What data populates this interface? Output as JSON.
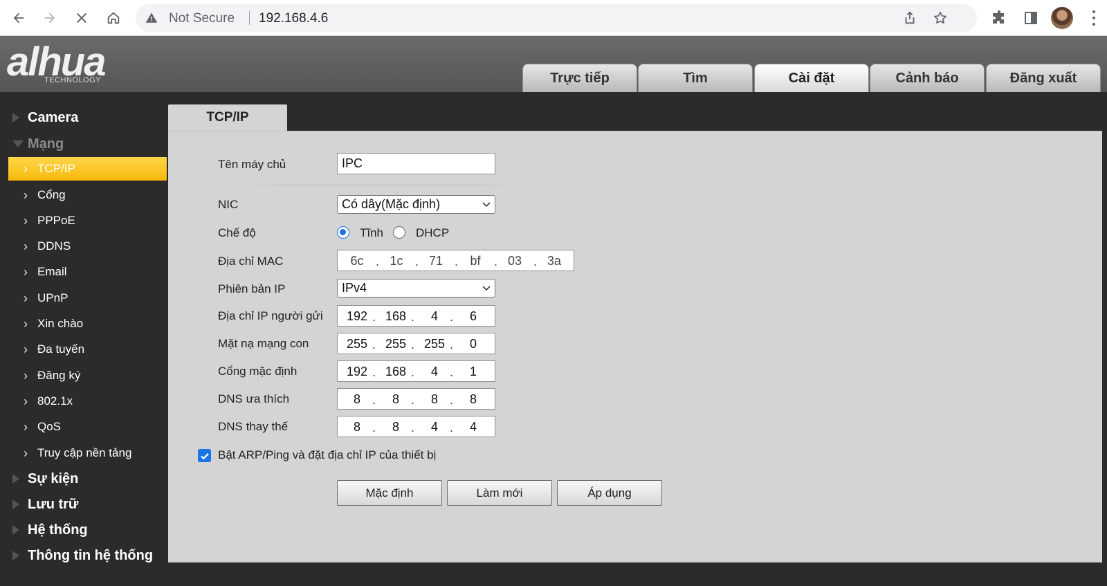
{
  "browser": {
    "security_label": "Not Secure",
    "url": "192.168.4.6"
  },
  "logo": {
    "main": "alhua",
    "sub": "TECHNOLOGY"
  },
  "top_tabs": [
    {
      "label": "Trực tiếp"
    },
    {
      "label": "Tìm"
    },
    {
      "label": "Cài đặt",
      "active": true
    },
    {
      "label": "Cảnh báo"
    },
    {
      "label": "Đăng xuất"
    }
  ],
  "sidebar": {
    "groups": [
      {
        "label": "Camera"
      },
      {
        "label": "Mạng",
        "open": true
      },
      {
        "label": "Sự kiện"
      },
      {
        "label": "Lưu trữ"
      },
      {
        "label": "Hệ thống"
      },
      {
        "label": "Thông tin hệ thống"
      }
    ],
    "network_items": [
      {
        "label": "TCP/IP",
        "active": true
      },
      {
        "label": "Cổng"
      },
      {
        "label": "PPPoE"
      },
      {
        "label": "DDNS"
      },
      {
        "label": "Email"
      },
      {
        "label": "UPnP"
      },
      {
        "label": "Xin chào"
      },
      {
        "label": "Đa tuyến"
      },
      {
        "label": "Đăng ký"
      },
      {
        "label": "802.1x"
      },
      {
        "label": "QoS"
      },
      {
        "label": "Truy cập nền tảng"
      }
    ]
  },
  "page_tab": "TCP/IP",
  "form": {
    "hostname": {
      "label": "Tên máy chủ",
      "value": "IPC"
    },
    "nic": {
      "label": "NIC",
      "value": "Có dây(Mặc định)"
    },
    "mode": {
      "label": "Chế độ",
      "options": [
        "Tĩnh",
        "DHCP"
      ],
      "selected": "Tĩnh"
    },
    "mac": {
      "label": "Địa chỉ MAC",
      "parts": [
        "6c",
        "1c",
        "71",
        "bf",
        "03",
        "3a"
      ]
    },
    "ip_version": {
      "label": "Phiên bản IP",
      "value": "IPv4"
    },
    "ip_address": {
      "label": "Địa chỉ IP người gửi",
      "parts": [
        "192",
        "168",
        "4",
        "6"
      ]
    },
    "subnet_mask": {
      "label": "Mặt nạ mạng con",
      "parts": [
        "255",
        "255",
        "255",
        "0"
      ]
    },
    "gateway": {
      "label": "Cổng mặc định",
      "parts": [
        "192",
        "168",
        "4",
        "1"
      ]
    },
    "dns_preferred": {
      "label": "DNS ưa thích",
      "parts": [
        "8",
        "8",
        "8",
        "8"
      ]
    },
    "dns_alternate": {
      "label": "DNS thay thế",
      "parts": [
        "8",
        "8",
        "4",
        "4"
      ]
    },
    "arp_ping": {
      "label": "Bật ARP/Ping và đặt địa chỉ IP của thiết bị",
      "checked": true
    }
  },
  "buttons": {
    "default": "Mặc định",
    "refresh": "Làm mới",
    "apply": "Áp dụng"
  },
  "colors": {
    "active_menu": "#f6b90a",
    "accent": "#1a73e8",
    "panel": "#d4d4d4",
    "sidebar": "#2b2b2b"
  }
}
